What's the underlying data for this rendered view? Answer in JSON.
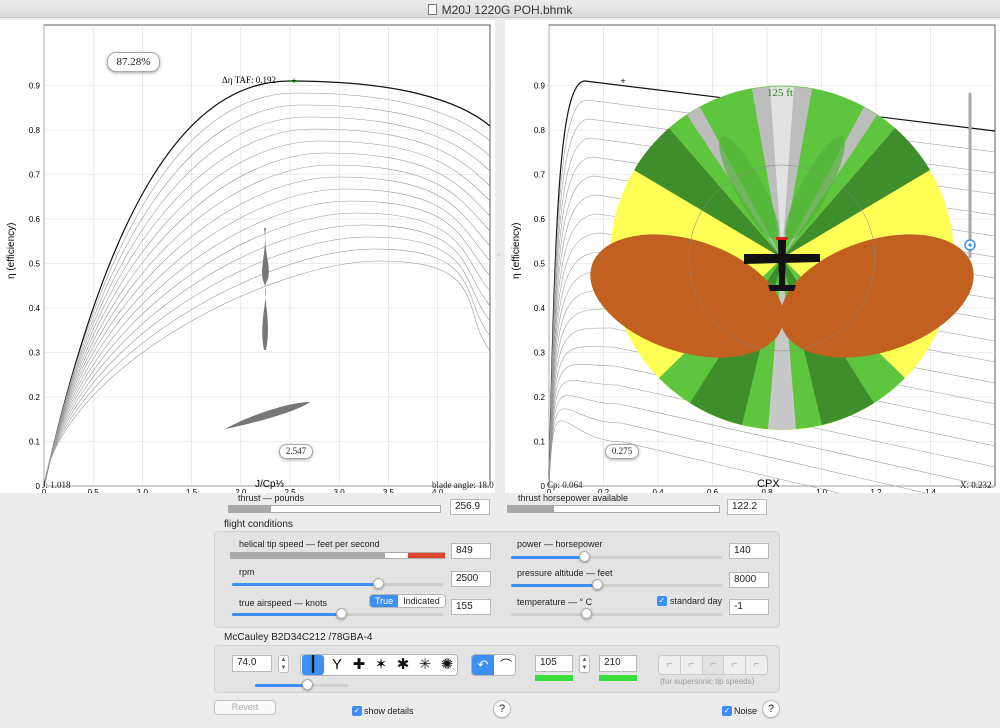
{
  "window": {
    "title": "M20J 1220G POH.bhmk"
  },
  "left_plot": {
    "ylabel": "η (efficiency)",
    "xlabel": "J/Cp⅓",
    "efficiency_bubble": "87.28%",
    "annotation": "Δη TAF: 0.192",
    "x_marker_value": "2.547",
    "bottom_left": "J: 1.018",
    "bottom_right": "blade angle: 18.0",
    "y_ticks": [
      "0",
      "0.1",
      "0.2",
      "0.3",
      "0.4",
      "0.5",
      "0.6",
      "0.7",
      "0.8",
      "0.9"
    ],
    "x_ticks": [
      "0",
      "0.5",
      "1.0",
      "1.5",
      "2.0",
      "2.5",
      "3.0",
      "3.5",
      "4.0"
    ]
  },
  "right_plot": {
    "ylabel": "η (efficiency)",
    "xlabel": "CPX",
    "altitude_label": "125 ft",
    "x_marker_value": "0.275",
    "bottom_left": "Cp: 0.064",
    "bottom_right": "X: 0.232",
    "y_ticks": [
      "0",
      "0.1",
      "0.2",
      "0.3",
      "0.4",
      "0.5",
      "0.6",
      "0.7",
      "0.8",
      "0.9"
    ],
    "x_ticks": [
      "0",
      "0.2",
      "0.4",
      "0.6",
      "0.8",
      "1.0",
      "1.2",
      "1.4"
    ]
  },
  "outputs": {
    "thrust_label": "thrust — pounds",
    "thrust_value": "256.9",
    "thrust_fraction": 0.2,
    "thp_label": "thrust horsepower available",
    "thp_value": "122.2",
    "thp_fraction": 0.22
  },
  "flight_conditions": {
    "heading": "flight conditions",
    "tip_speed_label": "helical tip speed — feet per second",
    "tip_speed_value": "849",
    "rpm_label": "rpm",
    "rpm_value": "2500",
    "tas_label": "true airspeed — knots",
    "tas_value": "155",
    "tas_mode_true": "True",
    "tas_mode_indicated": "Indicated",
    "power_label": "power — horsepower",
    "power_value": "140",
    "pressure_alt_label": "pressure altitude — feet",
    "pressure_alt_value": "8000",
    "temperature_label": "temperature — ° C",
    "temperature_value": "-1",
    "standard_day_label": "standard day"
  },
  "propeller": {
    "heading": "McCauley B2D34C212 /78GBA-4",
    "diameter_value": "74.0",
    "value_a": "105",
    "value_b": "210",
    "supersonic_note": "(for supersonic tip speeds)"
  },
  "footer": {
    "revert_label": "Revert",
    "show_details_label": "show details",
    "noise_label": "Noise",
    "help_glyph": "?"
  },
  "colors": {
    "accent": "#3d8ef5",
    "warning_red": "#e0442e",
    "zone_yellow": "#ffff55",
    "zone_orange": "#c1601f",
    "zone_green_light": "#5fc53f",
    "zone_green_dark": "#3e8f2b",
    "zone_gray": "#bdbdbd"
  }
}
